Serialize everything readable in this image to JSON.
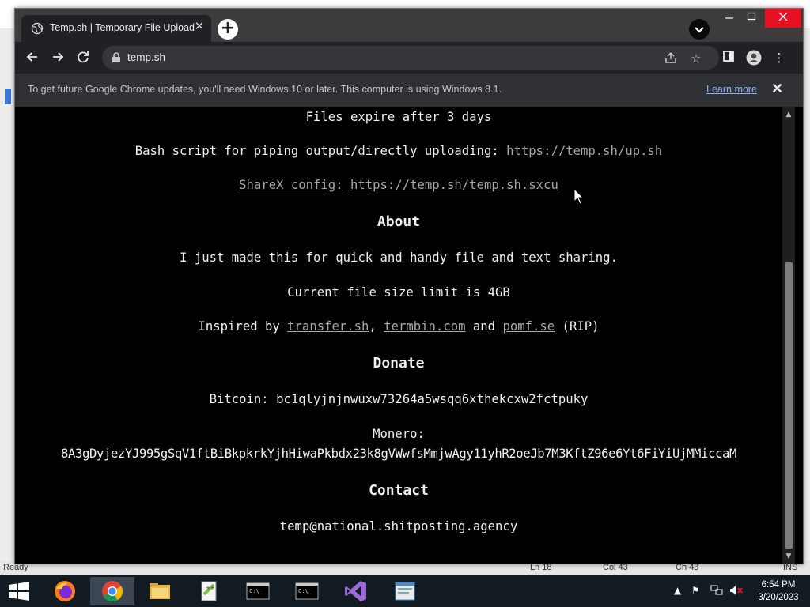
{
  "browser": {
    "tab_title": "Temp.sh | Temporary File Upload",
    "url": "temp.sh",
    "infobar_message": "To get future Google Chrome updates, you'll need Windows 10 or later. This computer is using Windows 8.1.",
    "infobar_link": "Learn more"
  },
  "page": {
    "expire_text": "Files expire after 3 days",
    "bash_text": "Bash script for piping output/directly uploading: ",
    "bash_link": "https://temp.sh/up.sh",
    "sharex_label": "ShareX config:",
    "sharex_link": "https://temp.sh/temp.sh.sxcu",
    "about_heading": "About",
    "about_text": "I just made this for quick and handy file and text sharing.",
    "size_limit": "Current file size limit is 4GB",
    "inspired_prefix": "Inspired by ",
    "inspired_link1": "transfer.sh",
    "inspired_sep1": ", ",
    "inspired_link2": "termbin.com",
    "inspired_sep2": " and ",
    "inspired_link3": "pomf.se",
    "inspired_suffix": " (RIP)",
    "donate_heading": "Donate",
    "bitcoin": "Bitcoin: bc1qlyjnjnwuxw73264a5wsqq6xthekcxw2fctpuky",
    "monero_label": "Monero:",
    "monero_address": "8A3gDyjezYJ995gSqV1ftBiBkpkrkYjhHiwaPkbdx23k8gVWwfsMmjwAgy11yhR2oeJb7M3KftZ96e6Yt6FiYiUjMMiccaM",
    "contact_heading": "Contact",
    "contact_email": "temp@national.shitposting.agency"
  },
  "background_window": {
    "status_ready": "Ready",
    "status_ln": "Ln 18",
    "status_col": "Col 43",
    "status_ch": "Ch 43",
    "status_ins": "INS"
  },
  "taskbar": {
    "time": "6:54 PM",
    "date": "3/20/2023"
  },
  "colors": {
    "page_bg": "#000000",
    "link": "#a8a8a8",
    "chrome_frame": "#3c3c3c",
    "close_red": "#e81123"
  }
}
